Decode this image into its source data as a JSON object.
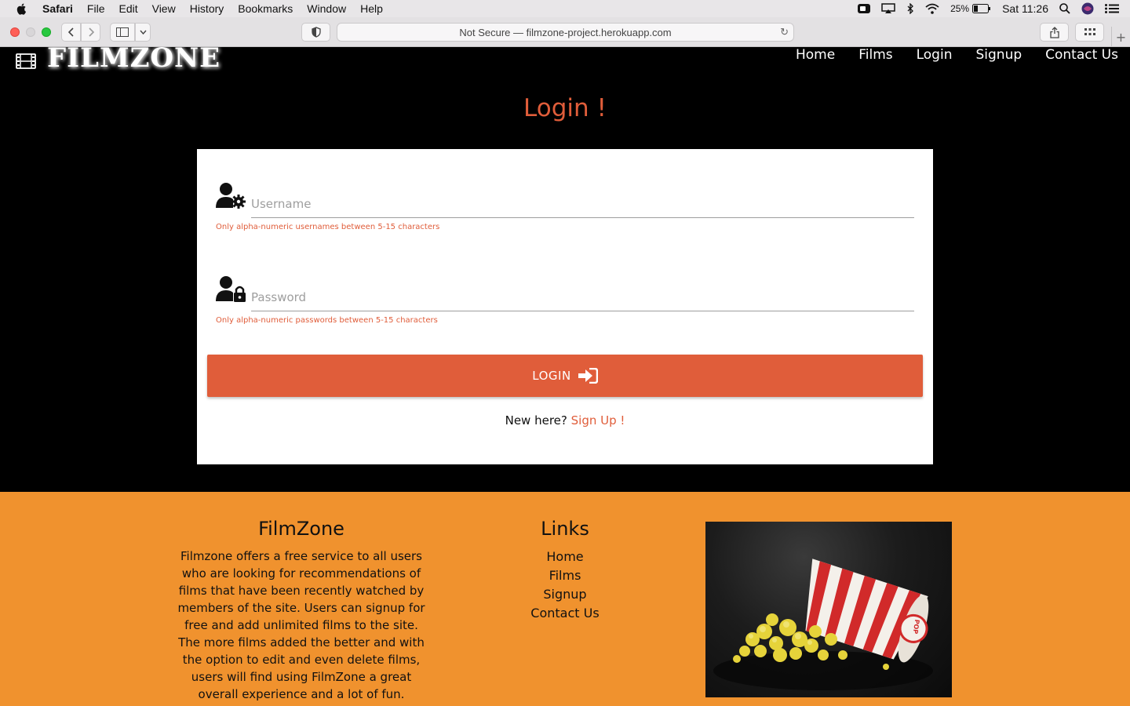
{
  "menubar": {
    "app": "Safari",
    "items": [
      "File",
      "Edit",
      "View",
      "History",
      "Bookmarks",
      "Window",
      "Help"
    ],
    "battery": "25%",
    "clock": "Sat 11:26"
  },
  "browser": {
    "address": "Not Secure — filmzone-project.herokuapp.com"
  },
  "site": {
    "logo": "FILMZONE",
    "nav": [
      "Home",
      "Films",
      "Login",
      "Signup",
      "Contact Us"
    ]
  },
  "login": {
    "title": "Login !",
    "username_placeholder": "Username",
    "username_helper": "Only alpha-numeric usernames between 5-15 characters",
    "password_placeholder": "Password",
    "password_helper": "Only alpha-numeric passwords between 5-15 characters",
    "button_label": "LOGIN",
    "new_here": "New here?",
    "signup_link": "Sign Up !"
  },
  "footer": {
    "about_title": "FilmZone",
    "about_text": "Filmzone offers a free service to all users who are looking for recommendations of films that have been recently watched by members of the site. Users can signup for free and add unlimited films to the site. The more films added the better and with the option to edit and even delete films, users will find using FilmZone a great overall experience and a lot of fun.",
    "links_title": "Links",
    "links": [
      "Home",
      "Films",
      "Signup",
      "Contact Us"
    ]
  },
  "colors": {
    "accent": "#e05d3a",
    "footer_bg": "#f0922e"
  }
}
